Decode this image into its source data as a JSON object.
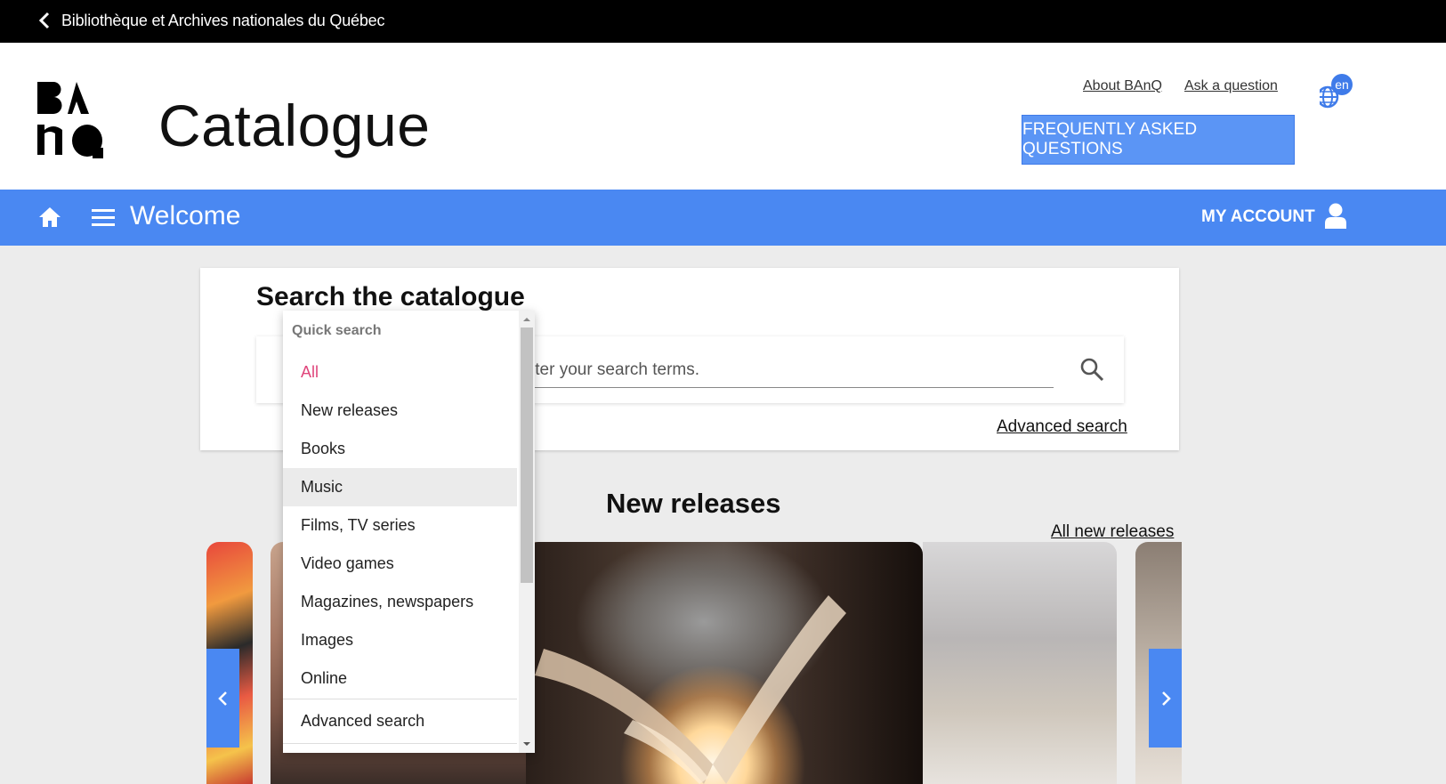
{
  "topbar": {
    "back_label": "Bibliothèque et Archives nationales du Québec"
  },
  "header": {
    "logo_text": "BAnQ",
    "title": "Catalogue",
    "links": {
      "about": "About BAnQ",
      "ask": "Ask a question"
    },
    "language": "en",
    "faq_button": "FREQUENTLY ASKED QUESTIONS"
  },
  "nav": {
    "welcome": "Welcome",
    "my_account": "MY ACCOUNT"
  },
  "search": {
    "heading": "Search the catalogue",
    "input_placeholder": "Enter your search terms.",
    "advanced_link": "Advanced search"
  },
  "new_releases": {
    "title": "New releases",
    "all_link": "All new releases"
  },
  "dropdown": {
    "header": "Quick search",
    "items": [
      {
        "label": "All",
        "state": "selected"
      },
      {
        "label": "New releases"
      },
      {
        "label": "Books"
      },
      {
        "label": "Music",
        "state": "hover"
      },
      {
        "label": "Films, TV series"
      },
      {
        "label": "Video games"
      },
      {
        "label": "Magazines, newspapers"
      },
      {
        "label": "Images"
      },
      {
        "label": "Online"
      }
    ],
    "footer_item": "Advanced search"
  },
  "colors": {
    "nav_blue": "#4a88f2",
    "faq_blue": "#5b95f5",
    "selected_pink": "#e0457b"
  },
  "icons": [
    "chevron-left-icon",
    "globe-icon",
    "home-icon",
    "menu-icon",
    "user-icon",
    "search-icon",
    "chevron-right-icon"
  ]
}
